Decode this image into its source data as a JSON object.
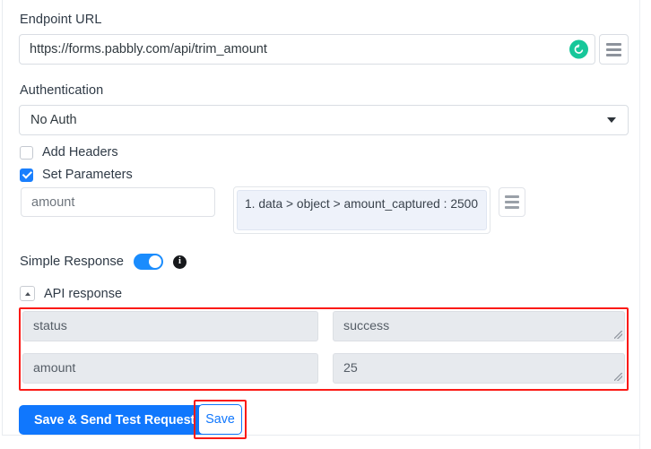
{
  "endpoint": {
    "label": "Endpoint URL",
    "value": "https://forms.pabbly.com/api/trim_amount",
    "refresh_icon": "refresh-icon",
    "menu_icon": "hamburger-menu-icon"
  },
  "authentication": {
    "label": "Authentication",
    "selected": "No Auth",
    "caret_icon": "chevron-down-icon"
  },
  "options": {
    "add_headers": {
      "label": "Add Headers",
      "checked": false
    },
    "set_parameters": {
      "label": "Set Parameters",
      "checked": true
    }
  },
  "parameters": {
    "key": "amount",
    "value": "1. data > object > amount_captured : 2500",
    "menu_icon": "hamburger-menu-icon"
  },
  "simple_response": {
    "label": "Simple Response",
    "enabled": true,
    "info_icon": "info-icon",
    "info_glyph": "i"
  },
  "api_response": {
    "label": "API response",
    "collapse_icon": "chevron-up-icon",
    "expanded": true,
    "rows": [
      {
        "key": "status",
        "value": "success"
      },
      {
        "key": "amount",
        "value": "25"
      }
    ]
  },
  "actions": {
    "primary_label": "Save & Send Test Request",
    "secondary_label": "Save"
  },
  "highlights": {
    "color": "#fb1a16",
    "targets": [
      "api-response-fields",
      "save-button"
    ]
  },
  "colors": {
    "primary_blue": "#1077fd",
    "toggle_blue": "#1a8cfd",
    "refresh_green": "#17c79a",
    "highlight_red": "#fb1a16",
    "field_gray": "#e7eaee",
    "chip_blue": "#eef2fa"
  }
}
